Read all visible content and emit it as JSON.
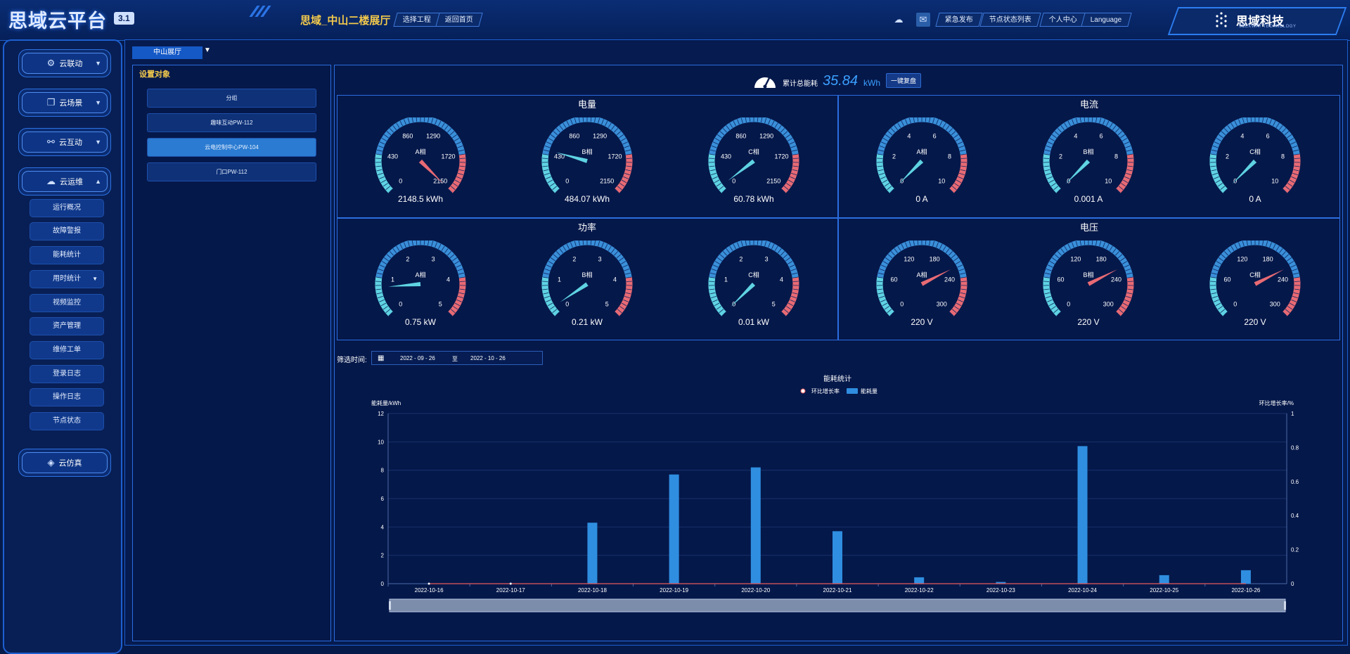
{
  "header": {
    "logo": "思域云平台",
    "version": "3.1",
    "project": "思域_中山二楼展厅",
    "buttons": [
      "选择工程",
      "返回首页"
    ],
    "right_buttons": [
      "紧急发布",
      "节点状态列表",
      "个人中心",
      "Language"
    ],
    "brand": "思域科技",
    "brand_sub": "SEEKWAY TECHNOLOGY"
  },
  "nav": {
    "groups": [
      {
        "label": "云联动",
        "icon": "cloud-link-icon",
        "chevron": "▼"
      },
      {
        "label": "云场景",
        "icon": "scene-icon",
        "chevron": "▼"
      },
      {
        "label": "云互动",
        "icon": "interact-icon",
        "chevron": "▼"
      },
      {
        "label": "云运维",
        "icon": "brain-icon",
        "chevron": "▲"
      }
    ],
    "sub_items": [
      "运行概况",
      "故障警报",
      "能耗统计",
      "用时统计",
      "视频监控",
      "资产管理",
      "维修工单",
      "登录日志",
      "操作日志",
      "节点状态"
    ],
    "sub_chevron": "▼",
    "last_group": {
      "label": "云仿真",
      "icon": "simulate-icon"
    }
  },
  "tab": {
    "label": "中山展厅",
    "chevron": "▼"
  },
  "left_panel": {
    "title": "设置对象",
    "items": [
      "分组",
      "趣味互动PW-112",
      "云电控制中心PW-104",
      "门口PW-112"
    ],
    "active_index": 2
  },
  "total": {
    "label": "累计总能耗",
    "value": "35.84",
    "unit": "kWh",
    "button": "一键复盘"
  },
  "quadrants": [
    {
      "title": "电量",
      "ticks": [
        "0",
        "430",
        "860",
        "1290",
        "1720",
        "2150"
      ],
      "max": 2150,
      "gauges": [
        {
          "phase": "A相",
          "value": 2148.5,
          "display": "2148.5 kWh",
          "needle_color": "#e86a74"
        },
        {
          "phase": "B相",
          "value": 484.07,
          "display": "484.07 kWh",
          "needle_color": "#5fd3e2"
        },
        {
          "phase": "C相",
          "value": 60.78,
          "display": "60.78 kWh",
          "needle_color": "#5fd3e2"
        }
      ]
    },
    {
      "title": "电流",
      "ticks": [
        "0",
        "2",
        "4",
        "6",
        "8",
        "10"
      ],
      "max": 10,
      "gauges": [
        {
          "phase": "A相",
          "value": 0,
          "display": "0 A",
          "needle_color": "#5fd3e2"
        },
        {
          "phase": "B相",
          "value": 0.001,
          "display": "0.001 A",
          "needle_color": "#5fd3e2"
        },
        {
          "phase": "C相",
          "value": 0,
          "display": "0 A",
          "needle_color": "#5fd3e2"
        }
      ]
    },
    {
      "title": "功率",
      "ticks": [
        "0",
        "1",
        "2",
        "3",
        "4",
        "5"
      ],
      "max": 5,
      "gauges": [
        {
          "phase": "A相",
          "value": 0.75,
          "display": "0.75 kW",
          "needle_color": "#5fd3e2"
        },
        {
          "phase": "B相",
          "value": 0.21,
          "display": "0.21 kW",
          "needle_color": "#5fd3e2"
        },
        {
          "phase": "C相",
          "value": 0.01,
          "display": "0.01 kW",
          "needle_color": "#5fd3e2"
        }
      ]
    },
    {
      "title": "电压",
      "ticks": [
        "0",
        "60",
        "120",
        "180",
        "240",
        "300"
      ],
      "max": 300,
      "gauges": [
        {
          "phase": "A相",
          "value": 220,
          "display": "220 V",
          "needle_color": "#e86a74"
        },
        {
          "phase": "B相",
          "value": 220,
          "display": "220 V",
          "needle_color": "#e86a74"
        },
        {
          "phase": "C相",
          "value": 220,
          "display": "220 V",
          "needle_color": "#e86a74"
        }
      ]
    }
  ],
  "filter": {
    "label": "筛选时间:",
    "from": "2022 - 09 - 26",
    "sep": "至",
    "to": "2022 - 10 - 26"
  },
  "chart_data": {
    "type": "bar",
    "title": "能耗统计",
    "legend": [
      "环比增长率",
      "能耗量"
    ],
    "ylabel": "能耗量/kWh",
    "y2label": "环比增长率/%",
    "categories": [
      "2022-10-16",
      "2022-10-17",
      "2022-10-18",
      "2022-10-19",
      "2022-10-20",
      "2022-10-21",
      "2022-10-22",
      "2022-10-23",
      "2022-10-24",
      "2022-10-25",
      "2022-10-26"
    ],
    "series": [
      {
        "name": "能耗量",
        "type": "bar",
        "values": [
          0,
          0,
          4.3,
          7.7,
          8.2,
          3.7,
          0.45,
          0.12,
          9.7,
          0.6,
          0.95
        ]
      },
      {
        "name": "环比增长率",
        "type": "line",
        "values": [
          0,
          0,
          0,
          0,
          0,
          0,
          0,
          0,
          0,
          0,
          0
        ]
      }
    ],
    "ylim": [
      0,
      12
    ],
    "yticks": [
      0,
      2,
      4,
      6,
      8,
      10,
      12
    ],
    "y2lim": [
      0,
      1
    ],
    "y2ticks": [
      0,
      0.2,
      0.4,
      0.6,
      0.8,
      1
    ],
    "colors": {
      "bar": "#2f8ee0",
      "line": "#e85a5a"
    }
  },
  "colors": {
    "accent": "#2b6de0",
    "gold": "#f2c94c",
    "gauge_low": "#5fd3e2",
    "gauge_mid": "#3a8fd9",
    "gauge_high": "#e86a74"
  }
}
